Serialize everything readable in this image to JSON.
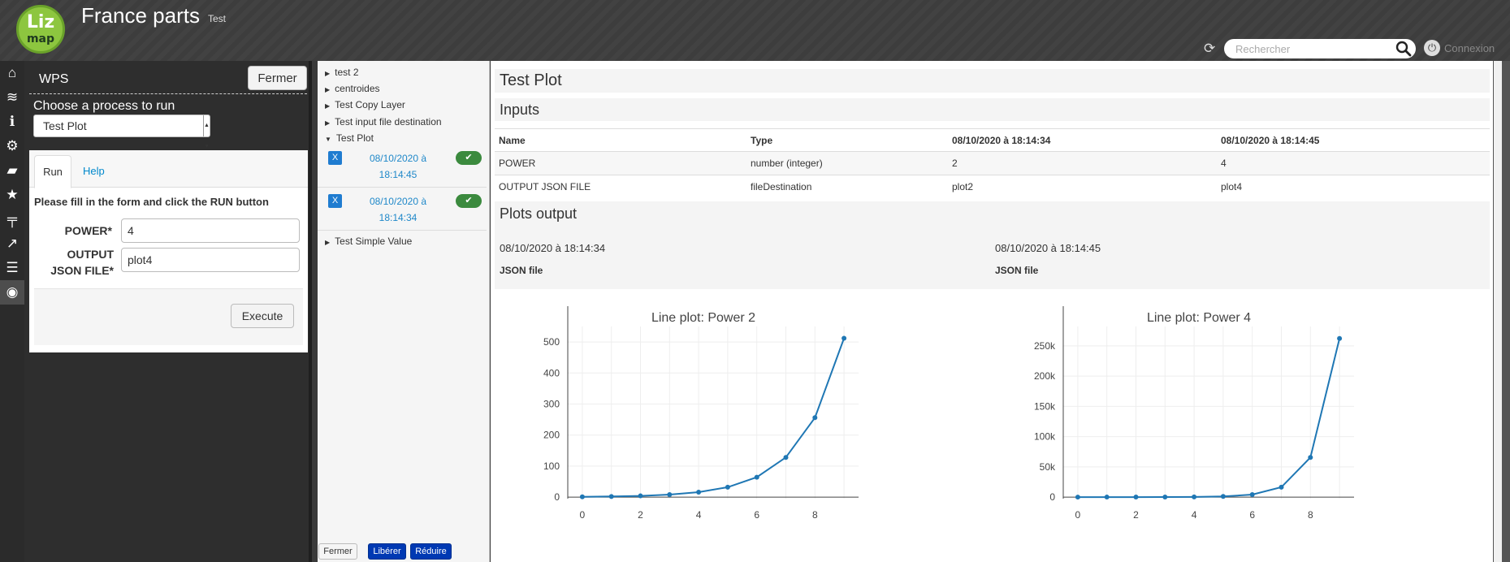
{
  "header": {
    "logo_top": "Liz",
    "logo_bottom": "map",
    "title": "France parts",
    "subtitle": "Test",
    "search_placeholder": "Rechercher",
    "connexion_label": "Connexion"
  },
  "iconbar": {
    "items": [
      "home-icon",
      "layers-icon",
      "info-icon",
      "gear-icon",
      "comment-icon",
      "star-icon",
      "signpost-icon",
      "share-icon",
      "list-icon",
      "eye-icon"
    ]
  },
  "wps": {
    "title": "WPS",
    "close_label": "Fermer",
    "choose_label": "Choose a process to run",
    "selected_process": "Test Plot",
    "tabs": {
      "run": "Run",
      "help": "Help"
    },
    "instructions": "Please fill in the form and click the RUN button",
    "fields": {
      "power": {
        "label": "POWER*",
        "value": "4"
      },
      "output": {
        "label_line1": "OUTPUT",
        "label_line2": "JSON FILE*",
        "value": "plot4"
      }
    },
    "execute_label": "Execute"
  },
  "processes": {
    "items": [
      "test 2",
      "centroides",
      "Test Copy Layer",
      "Test input file destination",
      "Test Plot",
      "Test Simple Value"
    ],
    "runs": [
      {
        "date_line1": "08/10/2020 à",
        "date_line2": "18:14:45"
      },
      {
        "date_line1": "08/10/2020 à",
        "date_line2": "18:14:34"
      }
    ],
    "buttons": {
      "close": "Fermer",
      "free": "Libérer",
      "reduce": "Réduire"
    }
  },
  "results": {
    "title": "Test Plot",
    "inputs_title": "Inputs",
    "table": {
      "headers": [
        "Name",
        "Type",
        "08/10/2020 à 18:14:34",
        "08/10/2020 à 18:14:45"
      ],
      "rows": [
        [
          "POWER",
          "number (integer)",
          "2",
          "4"
        ],
        [
          "OUTPUT JSON FILE",
          "fileDestination",
          "plot2",
          "plot4"
        ]
      ]
    },
    "plots_title": "Plots output",
    "plots": [
      {
        "date": "08/10/2020 à 18:14:34",
        "label": "JSON file"
      },
      {
        "date": "08/10/2020 à 18:14:45",
        "label": "JSON file"
      }
    ]
  },
  "colors": {
    "accent": "#1f77b4",
    "logo_green": "#8dc63f",
    "run_ok": "#3b8a3e",
    "run_x": "#1f7cd0"
  },
  "chart_data": [
    {
      "type": "line",
      "title": "Line plot: Power 2",
      "x": [
        0,
        1,
        2,
        3,
        4,
        5,
        6,
        7,
        8,
        9
      ],
      "series": [
        {
          "values": [
            1,
            2,
            4,
            8,
            16,
            32,
            64,
            128,
            256,
            512
          ]
        }
      ],
      "yticks": [
        0,
        100,
        200,
        300,
        400,
        500
      ],
      "ytick_labels": [
        "0",
        "100",
        "200",
        "300",
        "400",
        "500"
      ],
      "xticks": [
        0,
        2,
        4,
        6,
        8
      ],
      "xtick_labels": [
        "0",
        "2",
        "4",
        "6",
        "8"
      ],
      "xlim": [
        -0.5,
        9.5
      ],
      "ylim": [
        -5,
        550
      ],
      "grid": true,
      "color": "#1f77b4"
    },
    {
      "type": "line",
      "title": "Line plot: Power 4",
      "x": [
        0,
        1,
        2,
        3,
        4,
        5,
        6,
        7,
        8,
        9
      ],
      "series": [
        {
          "values": [
            1,
            4,
            16,
            64,
            256,
            1024,
            4096,
            16384,
            65536,
            262144
          ]
        }
      ],
      "yticks": [
        0,
        50000,
        100000,
        150000,
        200000,
        250000
      ],
      "ytick_labels": [
        "0",
        "50k",
        "100k",
        "150k",
        "200k",
        "250k"
      ],
      "xticks": [
        0,
        2,
        4,
        6,
        8
      ],
      "xtick_labels": [
        "0",
        "2",
        "4",
        "6",
        "8"
      ],
      "xlim": [
        -0.5,
        9.5
      ],
      "ylim": [
        -2600,
        282000
      ],
      "grid": true,
      "color": "#1f77b4"
    }
  ]
}
